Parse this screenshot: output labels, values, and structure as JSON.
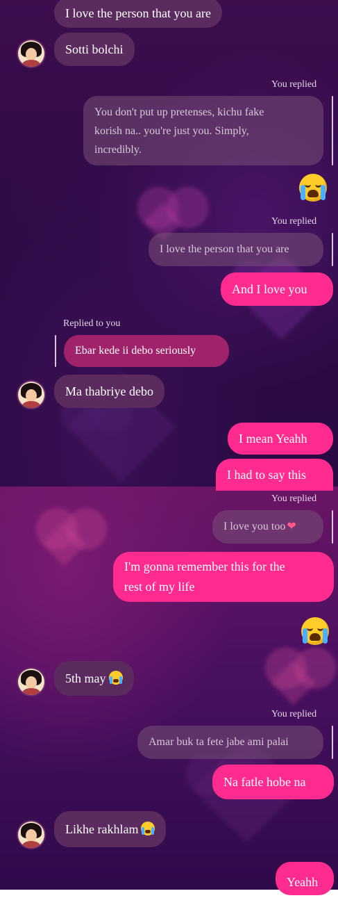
{
  "messages": {
    "m1": "I love the person that you are",
    "m2": "Sotti bolchi",
    "reply1_label": "You replied",
    "reply1_quote": [
      "You don't put up pretenses, kichu fake",
      "korish na.. you're just you. Simply,",
      "incredibly."
    ],
    "reply2_label": "You replied",
    "reply2_quote": "I love the person that you are",
    "m3": "And I love you",
    "replied_to_label": "Replied to you",
    "replied_to_quote": "Ebar kede ii debo seriously",
    "m4": "Ma thabriye debo",
    "m5": "I mean Yeahh",
    "m6": "I had to say this",
    "reply3_label": "You replied",
    "reply3_quote": "I love you too",
    "m7_line1": "I'm gonna remember this for the",
    "m7_line2": "rest of my life",
    "m8": "5th may",
    "reply4_label": "You replied",
    "reply4_quote": "Amar buk ta fete jabe ami palai",
    "m9": "Na fatle hobe na",
    "m10": "Likhe rakhlam",
    "m11": "Yeahh"
  },
  "colors": {
    "sent_bubble": "#ff2b8f",
    "received_bubble": "#5b2a5f"
  },
  "icons": {
    "crying_emoji": "loudly-crying-face-icon",
    "heart_emoji": "pink-heart-icon"
  }
}
